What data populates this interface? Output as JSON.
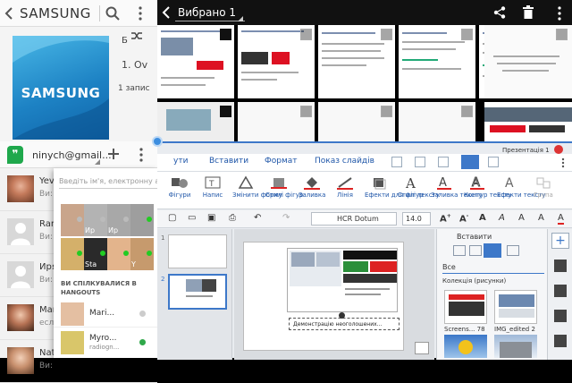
{
  "music": {
    "title": "SAMSUNG",
    "album_logo": "SAMSUNG",
    "partial_b": "Б",
    "track": "1. Ov",
    "count": "1 запис"
  },
  "gallery": {
    "selection": "Вибрано 1"
  },
  "hangouts": {
    "account": "ninych@gmail...",
    "search_placeholder": "Введіть ім'я, електронну адрес",
    "section_title": "ВИ СПІЛКУВАЛИСЯ В HANGOUTS",
    "contacts": [
      {
        "name": "Yevg",
        "sub": "Ви: в"
      },
      {
        "name": "Ran",
        "sub": "Ви: "
      },
      {
        "name": "Иря Х",
        "sub": "Ви: "
      },
      {
        "name": "Mari",
        "sub": "еслив"
      },
      {
        "name": "Nata",
        "sub": "Ви: "
      }
    ],
    "tiles": [
      "Ир",
      "Ир",
      "",
      "",
      "Sta",
      "Y"
    ],
    "recent": [
      {
        "name": "Mari...",
        "sub": ""
      },
      {
        "name": "Myro...",
        "sub": "radiogn..."
      }
    ]
  },
  "office": {
    "menu": [
      "ути",
      "Вставити",
      "Формат",
      "Показ слайдів"
    ],
    "doc_title": "Презентація 1",
    "ribbon": [
      {
        "label": "Фігури",
        "icon": "shapes-icon"
      },
      {
        "label": "Напис",
        "icon": "textbox-icon"
      },
      {
        "label": "Змінити форму",
        "icon": "edit-shape-icon"
      },
      {
        "label": "Стилі фігур",
        "icon": "shape-style-icon"
      },
      {
        "label": "Заливка",
        "icon": "fill-icon"
      },
      {
        "label": "Лінія",
        "icon": "line-icon"
      },
      {
        "label": "Ефекти для фігур",
        "icon": "shape-effects-icon"
      },
      {
        "label": "Стилі тексту",
        "icon": "text-style-icon"
      },
      {
        "label": "Заливка тексту",
        "icon": "text-fill-icon"
      },
      {
        "label": "Контур тексту",
        "icon": "text-outline-icon"
      },
      {
        "label": "Ефекти тексту",
        "icon": "text-effects-icon"
      },
      {
        "label": "Група",
        "icon": "group-icon"
      }
    ],
    "font_name": "HCR Dotum",
    "font_size": "14.0",
    "slide_numbers": [
      "1",
      "2"
    ],
    "slide_caption": "Демонстрацію неоголошених...",
    "panel_header": "Вставити",
    "filter": "Все",
    "collection": "Колекція (рисунки)",
    "images": [
      "Screens... 78",
      "IMG_edited 2"
    ]
  }
}
